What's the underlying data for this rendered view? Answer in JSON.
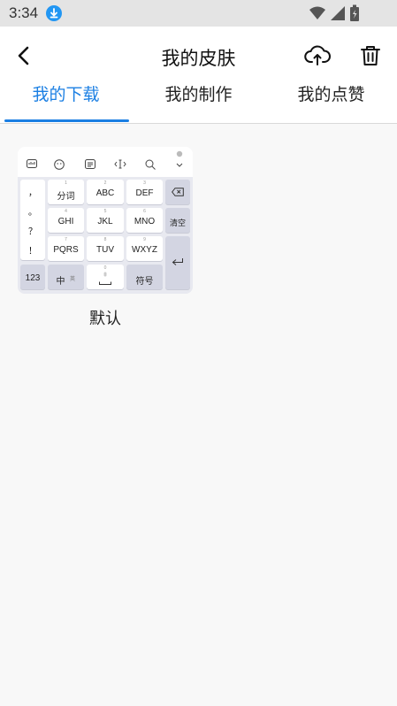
{
  "status_bar": {
    "time": "3:34",
    "icons": [
      "download-icon",
      "wifi-icon",
      "signal-icon",
      "battery-icon"
    ],
    "accent_color": "#2196f3"
  },
  "header": {
    "title": "我的皮肤",
    "back_icon": "chevron-left-icon",
    "upload_icon": "cloud-upload-icon",
    "delete_icon": "trash-icon"
  },
  "tabs": [
    {
      "label": "我的下载",
      "active": true
    },
    {
      "label": "我的制作",
      "active": false
    },
    {
      "label": "我的点赞",
      "active": false
    }
  ],
  "accent_color": "#1b7fe3",
  "skins": [
    {
      "name": "默认",
      "preview": {
        "toolbar_icons": [
          "keyboard-icon",
          "emoji-icon",
          "clipboard-icon",
          "cursor-icon",
          "search-icon",
          "collapse-icon"
        ],
        "punctuation": [
          "，",
          "。",
          "？",
          "！"
        ],
        "rows": [
          [
            {
              "label": "分词",
              "sub": "1"
            },
            {
              "label": "ABC",
              "sub": "2"
            },
            {
              "label": "DEF",
              "sub": "3"
            }
          ],
          [
            {
              "label": "GHI",
              "sub": "4"
            },
            {
              "label": "JKL",
              "sub": "5"
            },
            {
              "label": "MNO",
              "sub": "6"
            }
          ],
          [
            {
              "label": "PQRS",
              "sub": "7"
            },
            {
              "label": "TUV",
              "sub": "8"
            },
            {
              "label": "WXYZ",
              "sub": "9"
            }
          ]
        ],
        "bottom_row": {
          "numbers": "123",
          "lang": "中",
          "lang_sub": "英",
          "space_sub": "0",
          "symbols": "符号"
        },
        "right_keys": {
          "clear": "清空",
          "backspace_icon": "backspace-icon",
          "enter_icon": "enter-icon"
        }
      }
    }
  ]
}
